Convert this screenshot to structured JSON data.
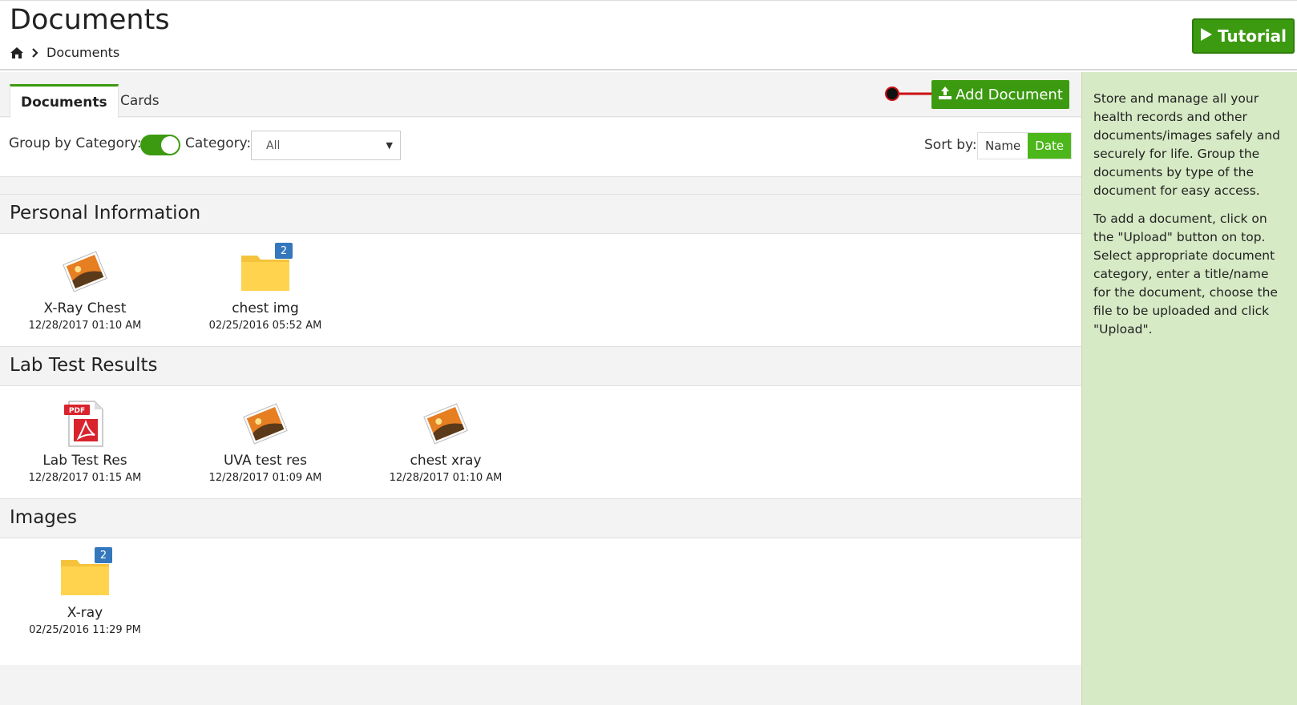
{
  "header": {
    "title": "Documents",
    "breadcrumb_current": "Documents",
    "tutorial_label": "Tutorial"
  },
  "tabs": [
    {
      "label": "Documents",
      "active": true
    },
    {
      "label": "Cards",
      "active": false
    }
  ],
  "toolbar": {
    "add_document_label": "Add Document"
  },
  "filters": {
    "group_by_label": "Group by Category:",
    "group_by_enabled": true,
    "category_label": "Category:",
    "category_value": "All",
    "sort_label": "Sort by:",
    "sort_options": [
      "Name",
      "Date"
    ],
    "sort_selected": "Date"
  },
  "categories": [
    {
      "name": "Personal Information",
      "items": [
        {
          "type": "image",
          "name": "X-Ray Chest",
          "date": "12/28/2017 01:10 AM"
        },
        {
          "type": "folder",
          "name": "chest img",
          "date": "02/25/2016 05:52 AM",
          "count": "2"
        }
      ]
    },
    {
      "name": "Lab Test Results",
      "items": [
        {
          "type": "pdf",
          "name": "Lab Test Res",
          "date": "12/28/2017 01:15 AM"
        },
        {
          "type": "image",
          "name": "UVA test res",
          "date": "12/28/2017 01:09 AM"
        },
        {
          "type": "image",
          "name": "chest xray",
          "date": "12/28/2017 01:10 AM"
        }
      ]
    },
    {
      "name": "Images",
      "items": [
        {
          "type": "folder",
          "name": "X-ray",
          "date": "02/25/2016 11:29 PM",
          "count": "2"
        }
      ]
    }
  ],
  "sidebar": {
    "paragraph_1": "Store and manage all your health records and other documents/images safely and securely for life. Group the documents by type of the document for easy access.",
    "paragraph_2": "To add a document, click on the \"Upload\" button on top. Select appropriate document category, enter a title/name for the document, choose the file to be uploaded and click \"Upload\"."
  },
  "colors": {
    "accent_green": "#3c9a10",
    "sidebar_bg": "#d6eac5",
    "badge_blue": "#3477bd",
    "pdf_red": "#d9232d",
    "folder_yellow": "#ffd34e"
  }
}
